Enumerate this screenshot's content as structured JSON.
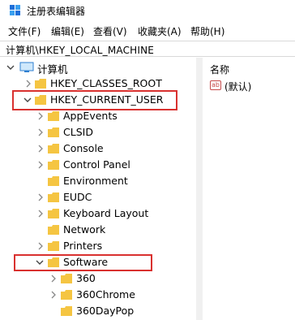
{
  "window": {
    "title": "注册表编辑器"
  },
  "menu": [
    "文件(F)",
    "编辑(E)",
    "查看(V)",
    "收藏夹(A)",
    "帮助(H)"
  ],
  "address": "计算机\\HKEY_LOCAL_MACHINE",
  "tree": {
    "root": "计算机",
    "hkey_classes_root": "HKEY_CLASSES_ROOT",
    "hkey_current_user": "HKEY_CURRENT_USER",
    "hkcu_children": [
      "AppEvents",
      "CLSID",
      "Console",
      "Control Panel",
      "Environment",
      "EUDC",
      "Keyboard Layout",
      "Network",
      "Printers"
    ],
    "software": "Software",
    "software_children": [
      "360",
      "360Chrome",
      "360DayPop"
    ]
  },
  "right_pane": {
    "column_name": "名称",
    "default_value_name": "(默认)",
    "default_value_icon_text": "ab"
  },
  "colors": {
    "highlight": "#d9312f",
    "folder": "#f5c542",
    "arrow": "#7a7a7a"
  }
}
